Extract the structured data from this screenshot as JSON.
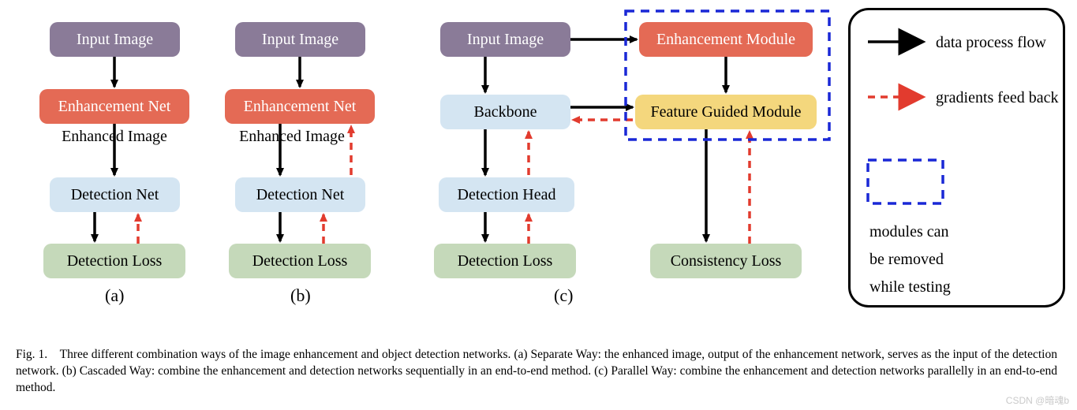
{
  "colA": {
    "input": "Input Image",
    "enh": "Enhancement Net",
    "enh_img": "Enhanced Image",
    "det": "Detection Net",
    "loss": "Detection Loss",
    "label": "(a)"
  },
  "colB": {
    "input": "Input Image",
    "enh": "Enhancement Net",
    "enh_img": "Enhanced Image",
    "det": "Detection Net",
    "loss": "Detection Loss",
    "label": "(b)"
  },
  "colC": {
    "input": "Input Image",
    "backbone": "Backbone",
    "head": "Detection Head",
    "loss": "Detection Loss",
    "enh_mod": "Enhancement Module",
    "fgm": "Feature Guided Module",
    "cons": "Consistency Loss",
    "label": "(c)"
  },
  "legend": {
    "flow": "data process flow",
    "grad": "gradients feed back",
    "remove1": "modules can",
    "remove2": "be removed",
    "remove3": "while testing"
  },
  "caption": "Fig. 1. Three different combination ways of the image enhancement and object detection networks. (a) Separate Way: the enhanced image, output of the enhancement network, serves as the input of the detection network. (b) Cascaded Way: combine the enhancement and detection networks sequentially in an end-to-end method. (c) Parallel Way: combine the enhancement and detection networks parallelly in an end-to-end method.",
  "watermark": "CSDN @暗魂b"
}
